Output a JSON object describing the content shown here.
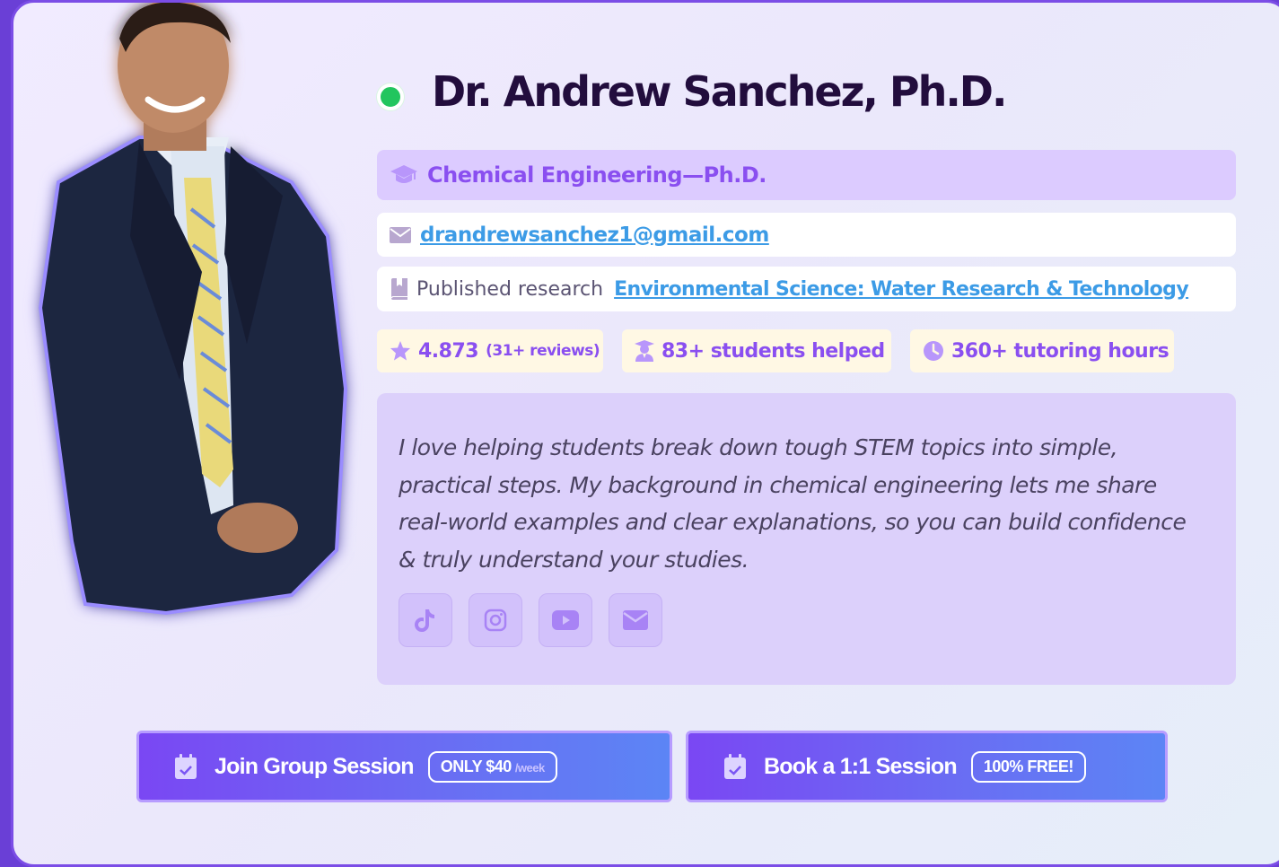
{
  "tutor": {
    "name": "Dr. Andrew Sanchez, Ph.D.",
    "status": "online",
    "degree": "Chemical Engineering—Ph.D.",
    "email": "drandrewsanchez1@gmail.com",
    "research_label": "Published research",
    "research_link": "Environmental Science: Water Research & Technology"
  },
  "stats": {
    "rating": "4.873",
    "reviews": "(31+ reviews)",
    "students": "83+ students helped",
    "hours": "360+ tutoring hours"
  },
  "bio": "I love helping students break down tough STEM topics into simple, practical steps. My background in chemical engineering lets me share real-world examples and clear explanations, so you can build confidence & truly understand your studies.",
  "socials": [
    "tiktok-icon",
    "instagram-icon",
    "youtube-icon",
    "mail-icon"
  ],
  "cta": {
    "group_label": "Join Group Session",
    "group_price": "ONLY $40",
    "group_period": "/week",
    "book_label": "Book a 1:1 Session",
    "book_price": "100% FREE!"
  },
  "colors": {
    "accent": "#8a4ff0",
    "link": "#3c9be6",
    "online": "#22c55e",
    "name": "#220d3d"
  }
}
